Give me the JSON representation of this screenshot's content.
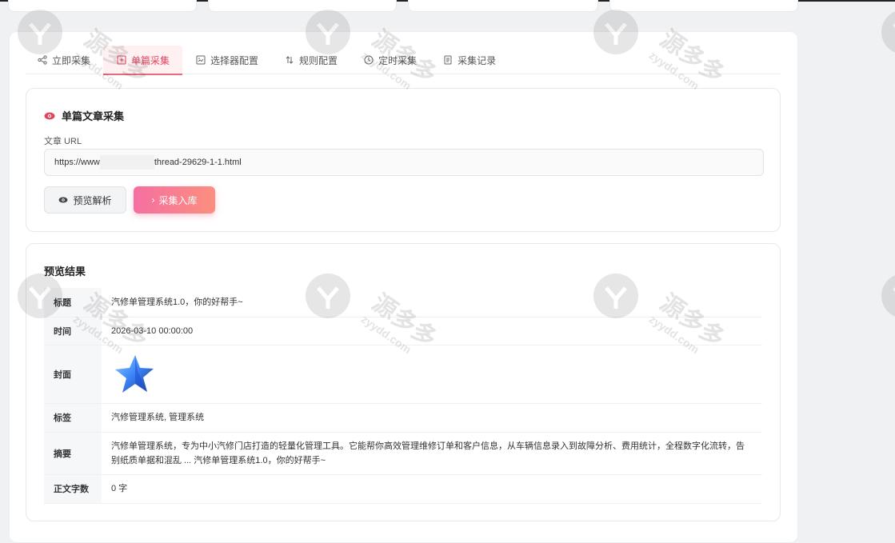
{
  "tabs": [
    {
      "label": "立即采集",
      "icon": "share-icon",
      "active": false
    },
    {
      "label": "单篇采集",
      "icon": "plus-square-icon",
      "active": true
    },
    {
      "label": "选择器配置",
      "icon": "image-box-icon",
      "active": false
    },
    {
      "label": "规则配置",
      "icon": "sort-arrows-icon",
      "active": false
    },
    {
      "label": "定时采集",
      "icon": "clock-icon",
      "active": false
    },
    {
      "label": "采集记录",
      "icon": "document-icon",
      "active": false
    }
  ],
  "form": {
    "title": "单篇文章采集",
    "url_label": "文章 URL",
    "url_prefix": "https://www",
    "url_suffix": "thread-29629-1-1.html",
    "preview_button": "预览解析",
    "collect_button": "采集入库"
  },
  "result": {
    "title": "预览结果",
    "rows": {
      "title_key": "标题",
      "title_value": "汽修单管理系统1.0，你的好帮手~",
      "time_key": "时间",
      "time_value": "2026-03-10 00:00:00",
      "cover_key": "封面",
      "tags_key": "标签",
      "tags_value": "汽修管理系统, 管理系统",
      "summary_key": "摘要",
      "summary_value": "汽修单管理系统，专为中小汽修门店打造的轻量化管理工具。它能帮你高效管理维修订单和客户信息，从车辆信息录入到故障分析、费用统计，全程数字化流转，告别纸质单据和混乱 ... 汽修单管理系统1.0，你的好帮手~",
      "wordcount_key": "正文字数",
      "wordcount_value": "0 字"
    }
  },
  "watermark": {
    "text": "源多多",
    "sub": "zyydd.com"
  },
  "colors": {
    "accent": "#e0455d",
    "gradient_start": "#f56fa2",
    "gradient_end": "#fb8f7e"
  }
}
